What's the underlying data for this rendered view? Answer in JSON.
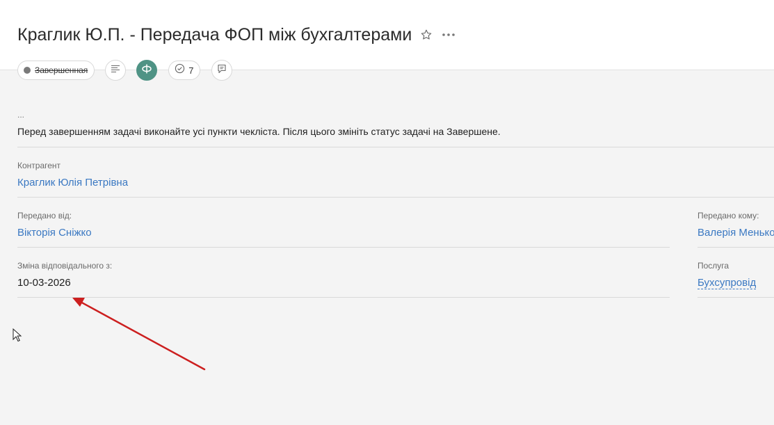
{
  "header": {
    "title": "Краглик Ю.П. - Передача ФОП між бухгалтерами",
    "status_label": "Завершенная",
    "checklist_count": "7"
  },
  "task": {
    "ellipsis": "...",
    "description": "Перед завершенням задачі виконайте усі пункти чекліста. Після цього змініть статус задачі на Завершене."
  },
  "fields": {
    "counterparty_label": "Контрагент",
    "counterparty_value": "Краглик Юлія Петрівна",
    "transferred_from_label": "Передано від:",
    "transferred_from_value": "Вікторія Сніжко",
    "transferred_to_label": "Передано кому:",
    "transferred_to_value": "Валерія Менько",
    "change_date_label": "Зміна відповідального з:",
    "change_date_value": "10-03-2026",
    "service_label": "Послуга",
    "service_value": "Бухсупровід"
  },
  "colors": {
    "link": "#3a78c2",
    "accent_green": "#4f9385",
    "annotation_arrow": "#cc1f1f",
    "status_dot": "#7a7a7a"
  },
  "icons": [
    "star-icon",
    "more-icon",
    "description-icon",
    "company-icon",
    "checklist-icon",
    "comment-icon",
    "cursor-icon"
  ]
}
